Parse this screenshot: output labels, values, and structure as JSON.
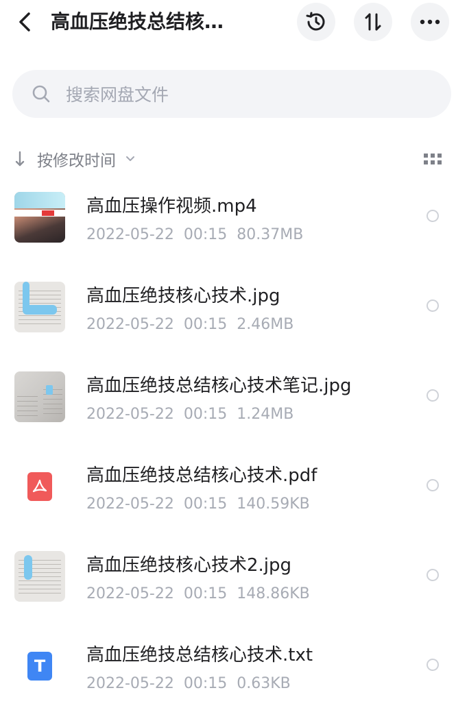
{
  "header": {
    "back_icon": "chevron-left-icon",
    "title": "高血压绝技总结核…",
    "actions": [
      {
        "name": "history",
        "icon": "history-clock-icon"
      },
      {
        "name": "sort",
        "icon": "sort-arrows-icon",
        "glyph": "⇅"
      },
      {
        "name": "more",
        "icon": "more-dots-icon"
      }
    ]
  },
  "search": {
    "placeholder": "搜索网盘文件",
    "icon": "search-icon"
  },
  "sort": {
    "label": "按修改时间",
    "arrow_icon": "arrow-down-icon",
    "caret_icon": "chevron-down-icon",
    "view_toggle_icon": "grid-view-icon"
  },
  "files": [
    {
      "name": "高血压操作视频.mp4",
      "date": "2022-05-22",
      "time": "00:15",
      "size": "80.37MB",
      "thumb": "video"
    },
    {
      "name": "高血压绝技核心技术.jpg",
      "date": "2022-05-22",
      "time": "00:15",
      "size": "2.46MB",
      "thumb": "note"
    },
    {
      "name": "高血压绝技总结核心技术笔记.jpg",
      "date": "2022-05-22",
      "time": "00:15",
      "size": "1.24MB",
      "thumb": "photo"
    },
    {
      "name": "高血压绝技总结核心技术.pdf",
      "date": "2022-05-22",
      "time": "00:15",
      "size": "140.59KB",
      "thumb": "pdf-icon"
    },
    {
      "name": "高血压绝技核心技术2.jpg",
      "date": "2022-05-22",
      "time": "00:15",
      "size": "148.86KB",
      "thumb": "note"
    },
    {
      "name": "高血压绝技总结核心技术.txt",
      "date": "2022-05-22",
      "time": "00:15",
      "size": "0.63KB",
      "thumb": "txt-icon",
      "thumb_glyph": "T"
    }
  ],
  "colors": {
    "pdf_icon": "#f05a5a",
    "txt_icon": "#3f86f4",
    "meta_text": "#a7abb4",
    "button_bg": "#f2f3f5",
    "search_bg": "#f3f4f7"
  }
}
